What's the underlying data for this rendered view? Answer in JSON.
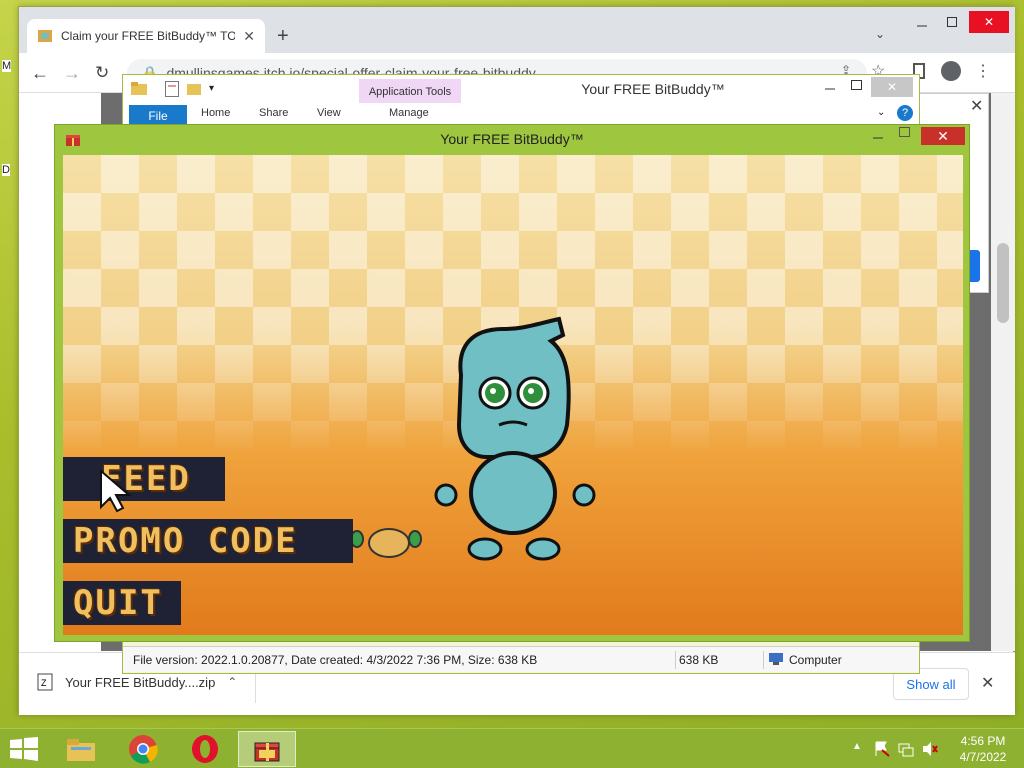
{
  "desktop": {
    "letters": [
      "M",
      "D"
    ]
  },
  "chrome": {
    "tab_title": "Claim your FREE BitBuddy™ TOD",
    "new_tab_symbol": "+",
    "url": "dmullinsgames.itch.io/special-offer-claim-your-free-bitbuddy",
    "download": {
      "filename": "Your FREE BitBuddy....zip"
    },
    "show_all": "Show all"
  },
  "explorer": {
    "title": "Your FREE BitBuddy™",
    "context_tab": "Application Tools",
    "tabs": {
      "file": "File",
      "home": "Home",
      "share": "Share",
      "view": "View",
      "manage": "Manage"
    },
    "status_info": "File version: 2022.1.0.20877, Date created: 4/3/2022 7:36 PM, Size: 638 KB",
    "status_size": "638 KB",
    "status_location": "Computer"
  },
  "game": {
    "title": "Your FREE BitBuddy™",
    "menu": {
      "feed": "FEED",
      "promo": "PROMO CODE",
      "quit": "QUIT"
    }
  },
  "taskbar": {
    "time": "4:56 PM",
    "date": "4/7/2022"
  },
  "colors": {
    "chrome_accent": "#1a73e8",
    "taskbar": "#8eb131",
    "game_frame": "#9ec63f",
    "buddy": "#6fbfc4"
  },
  "icons": [
    "file-explorer-icon",
    "chrome-icon",
    "opera-icon",
    "bitbuddy-icon",
    "windows-start-icon"
  ]
}
